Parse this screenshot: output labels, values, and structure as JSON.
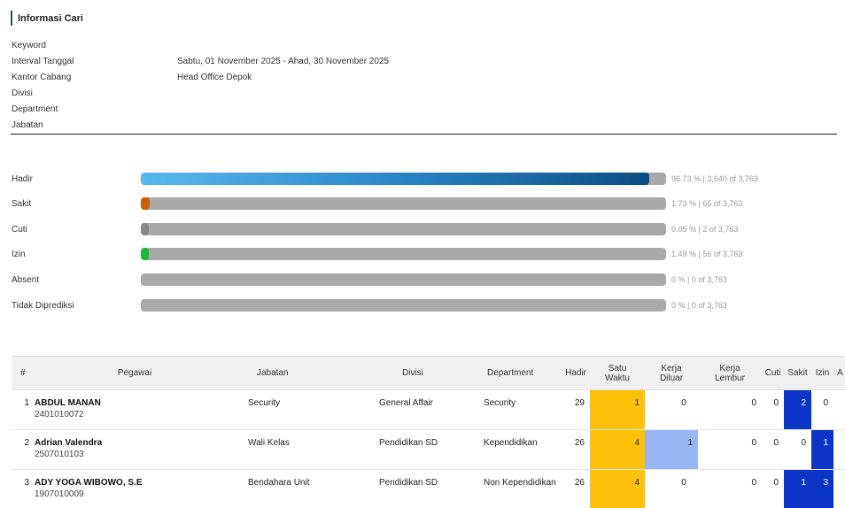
{
  "info": {
    "heading": "Informasi Cari",
    "rows": [
      {
        "label": "Keyword",
        "value": ""
      },
      {
        "label": "Interval Tanggal",
        "value": "Sabtu, 01 November 2025 - Ahad, 30 November 2025"
      },
      {
        "label": "Kantor Cabang",
        "value": "Head Office Depok"
      },
      {
        "label": "Divisi",
        "value": ""
      },
      {
        "label": "Department",
        "value": ""
      },
      {
        "label": "Jabatan",
        "value": ""
      }
    ]
  },
  "stats": [
    {
      "label": "Hadir",
      "percent": 96.73,
      "text": "96.73 % | 3,640 of 3,763",
      "color": "#1b6ea8"
    },
    {
      "label": "Sakit",
      "percent": 1.73,
      "text": "1.73 % | 65 of 3,763",
      "color": "#c8620a"
    },
    {
      "label": "Cuti",
      "percent": 0.05,
      "text": "0.05 % | 2 of 3,763",
      "color": "#888888"
    },
    {
      "label": "Izin",
      "percent": 1.49,
      "text": "1.49 % | 56 of 3,763",
      "color": "#1fb83c"
    },
    {
      "label": "Absent",
      "percent": 0,
      "text": "0 % | 0 of 3,763",
      "color": "#a9a9a9"
    },
    {
      "label": "Tidak Diprediksi",
      "percent": 0,
      "text": "0 % | 0 of 3,763",
      "color": "#a9a9a9"
    }
  ],
  "table": {
    "headers": {
      "no": "#",
      "pegawai": "Pegawai",
      "jabatan": "Jabatan",
      "divisi": "Divisi",
      "department": "Department",
      "hadir": "Hadir",
      "satu_waktu_1": "Satu",
      "satu_waktu_2": "Waktu",
      "kerja_diluar_1": "Kerja",
      "kerja_diluar_2": "Diluar",
      "kerja_lembur_1": "Kerja",
      "kerja_lembur_2": "Lembur",
      "cuti": "Cuti",
      "sakit": "Sakit",
      "izin": "Izin",
      "a": "A"
    },
    "rows": [
      {
        "no": "1",
        "name": "ABDUL MANAN",
        "id": "2401010072",
        "jabatan": "Security",
        "divisi": "General Affair",
        "department": "Security",
        "hadir": "29",
        "satu_waktu": "1",
        "kerja_diluar": "0",
        "kerja_lembur": "0",
        "cuti": "0",
        "sakit": "2",
        "izin": "0"
      },
      {
        "no": "2",
        "name": "Adrian Valendra",
        "id": "2507010103",
        "jabatan": "Wali Kelas",
        "divisi": "Pendidikan SD",
        "department": "Kependidikan",
        "hadir": "26",
        "satu_waktu": "4",
        "kerja_diluar": "1",
        "kerja_lembur": "0",
        "cuti": "0",
        "sakit": "0",
        "izin": "1"
      },
      {
        "no": "3",
        "name": "ADY YOGA WIBOWO, S.E",
        "id": "1907010009",
        "jabatan": "Bendahara Unit",
        "divisi": "Pendidikan SD",
        "department": "Non Kependidikan",
        "hadir": "26",
        "satu_waktu": "4",
        "kerja_diluar": "0",
        "kerja_lembur": "0",
        "cuti": "0",
        "sakit": "1",
        "izin": "3"
      }
    ]
  },
  "colors": {
    "highlight_yellow": "#fdc10b",
    "highlight_lightblue": "#99b6f5",
    "highlight_blue": "#0a35c6"
  }
}
